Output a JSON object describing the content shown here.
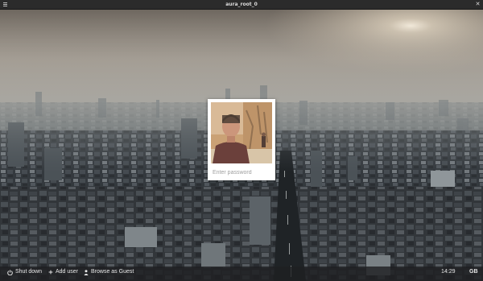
{
  "window": {
    "title": "aura_root_0"
  },
  "login": {
    "password_placeholder": "Enter password"
  },
  "bottombar": {
    "shutdown_label": "Shut down",
    "add_user_label": "Add user",
    "guest_label": "Browse as Guest",
    "clock": "14:29",
    "keyboard_layout": "GB"
  },
  "icons": {
    "menu": "hamburger-menu-icon",
    "close": "close-icon",
    "power": "power-icon",
    "add_user": "plus-icon",
    "guest": "person-icon"
  },
  "colors": {
    "titlebar": "#2b2b2b",
    "bottombar": "#1e2022",
    "card": "#ffffff",
    "placeholder": "#a0a0a0"
  }
}
